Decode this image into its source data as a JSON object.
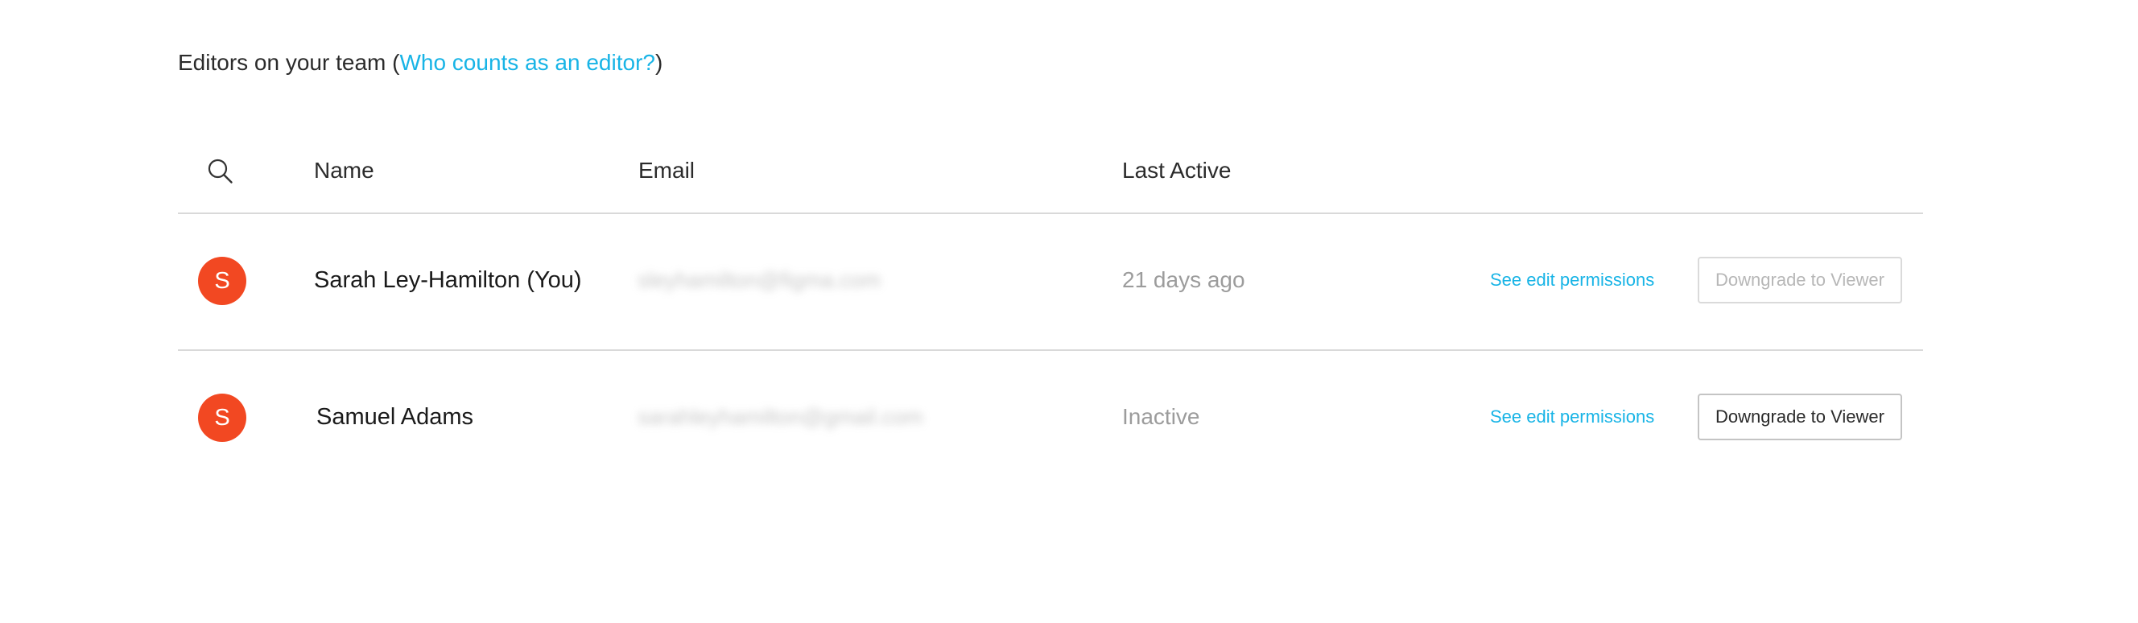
{
  "heading": {
    "prefix": "Editors on your team (",
    "link": "Who counts as an editor?",
    "suffix": ")"
  },
  "table": {
    "columns": {
      "name": "Name",
      "email": "Email",
      "last_active": "Last Active"
    },
    "rows": [
      {
        "avatar": "S",
        "name": "Sarah Ley-Hamilton (You)",
        "email": "sleyhamilton@figma.com",
        "last_active": "21 days ago",
        "permissions_link": "See edit permissions",
        "action": "Downgrade to Viewer",
        "action_enabled": false
      },
      {
        "avatar": "S",
        "name": "Samuel Adams",
        "email": "sarahleyhamilton@gmail.com",
        "last_active": "Inactive",
        "permissions_link": "See edit permissions",
        "action": "Downgrade to Viewer",
        "action_enabled": true
      }
    ]
  },
  "colors": {
    "accent": "#18b4e6",
    "avatar": "#f24822",
    "divider": "#d9d9d9"
  },
  "icons": {
    "search": "search-icon"
  }
}
